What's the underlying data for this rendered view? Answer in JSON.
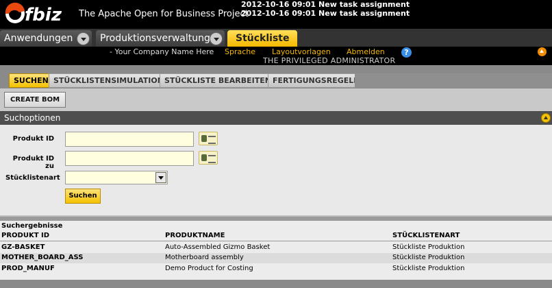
{
  "header": {
    "logo_text": "ofbiz",
    "brand": "The Apache Open for Business Project",
    "notices": [
      "2012-10-16 09:01 New task assignment",
      "2012-10-16 09:01 New task assignment"
    ]
  },
  "app_tabs": [
    {
      "label": "Anwendungen"
    },
    {
      "label": "Produktionsverwaltung"
    },
    {
      "label": "Stückliste"
    }
  ],
  "userbar": {
    "company": "- Your Company Name Here",
    "links": [
      "Sprache",
      "Layoutvorlagen",
      "Abmelden"
    ],
    "admin": "THE PRIVILEGED ADMINISTRATOR"
  },
  "subtabs": [
    {
      "label": "SUCHEN",
      "active": true
    },
    {
      "label": "STÜCKLISTENSIMULATION",
      "active": false
    },
    {
      "label": "STÜCKLISTE BEARBEITEN",
      "active": false
    },
    {
      "label": "FERTIGUNGSREGELN",
      "active": false
    }
  ],
  "create_button": "CREATE BOM",
  "search_options": {
    "title": "Suchoptionen",
    "fields": {
      "product_id_label": "Produkt ID",
      "product_id_value": "",
      "product_id_to_label": "Produkt ID zu",
      "product_id_to_value": "",
      "bom_type_label": "Stücklistenart",
      "bom_type_value": ""
    },
    "search_button": "Suchen"
  },
  "results": {
    "title": "Suchergebnisse",
    "columns": [
      "PRODUKT ID",
      "PRODUKTNAME",
      "STÜCKLISTENART"
    ],
    "rows": [
      [
        "GZ-BASKET",
        "Auto-Assembled Gizmo Basket",
        "Stückliste Produktion"
      ],
      [
        "MOTHER_BOARD_ASS",
        "Motherboard assembly",
        "Stückliste Produktion"
      ],
      [
        "PROD_MANUF",
        "Demo Product for Costing",
        "Stückliste Produktion"
      ]
    ]
  },
  "colors": {
    "accent": "#f4c200",
    "header_bg": "#000000",
    "input_bg": "#ffffe0"
  }
}
